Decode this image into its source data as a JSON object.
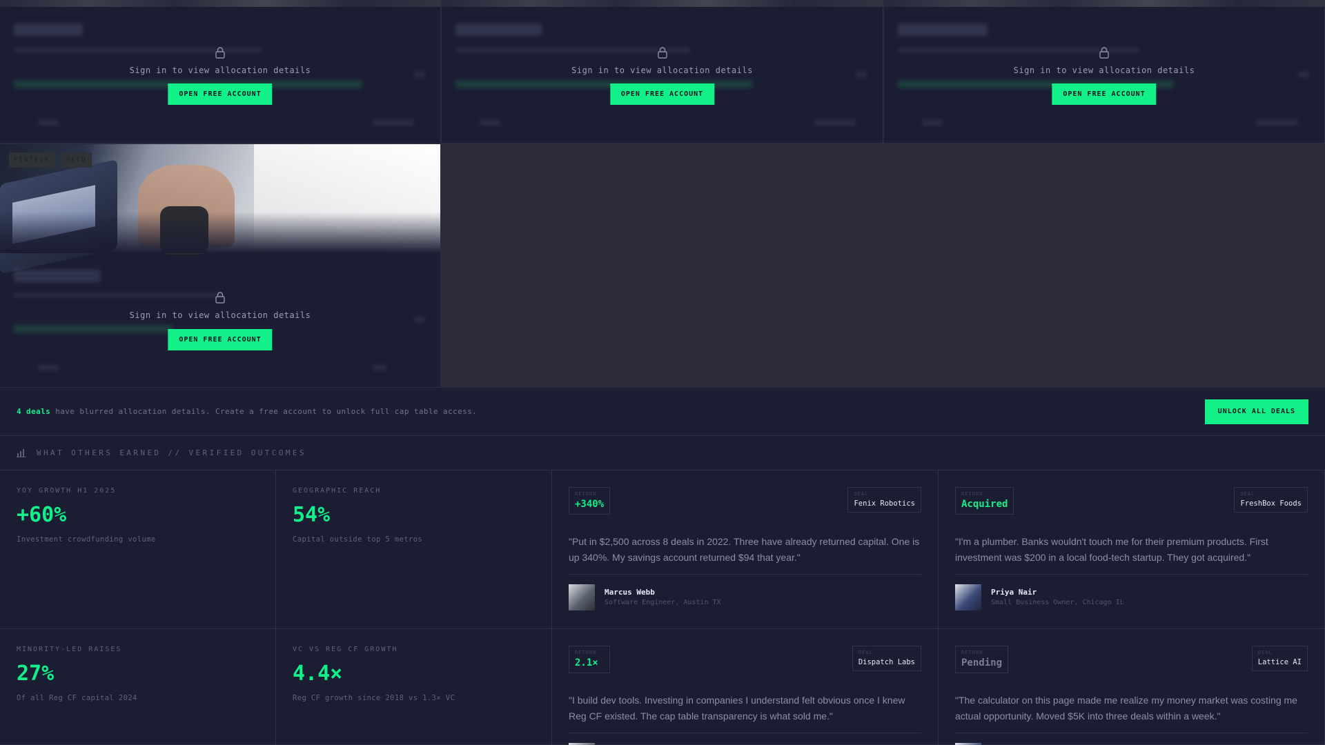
{
  "deal_cards": [
    {
      "signin": "Sign in to view allocation details",
      "cta": "OPEN FREE ACCOUNT"
    },
    {
      "signin": "Sign in to view allocation details",
      "cta": "OPEN FREE ACCOUNT"
    },
    {
      "signin": "Sign in to view allocation details",
      "cta": "OPEN FREE ACCOUNT"
    },
    {
      "signin": "Sign in to view allocation details",
      "cta": "OPEN FREE ACCOUNT",
      "tags": [
        "FINTECH",
        "SEED"
      ]
    }
  ],
  "banner": {
    "highlight": "4 deals",
    "text": "have blurred allocation details. Create a free account to unlock full cap table access.",
    "button": "UNLOCK ALL DEALS"
  },
  "outcomes": {
    "icon": "bar-chart-icon",
    "label": "WHAT OTHERS EARNED // VERIFIED OUTCOMES"
  },
  "stats": [
    {
      "label": "YOY GROWTH H1 2025",
      "value": "+60%",
      "desc": "Investment crowdfunding volume"
    },
    {
      "label": "GEOGRAPHIC REACH",
      "value": "54%",
      "desc": "Capital outside top 5 metros"
    },
    {
      "label": "MINORITY-LED RAISES",
      "value": "27%",
      "desc": "Of all Reg CF capital 2024"
    },
    {
      "label": "VC VS REG CF GROWTH",
      "value": "4.4×",
      "desc": "Reg CF growth since 2018 vs 1.3× VC"
    }
  ],
  "testimonials": [
    {
      "return_label": "RETURN",
      "return": "+340%",
      "deal_label": "DEAL",
      "deal": "Fenix Robotics",
      "quote": "\"Put in $2,500 across 8 deals in 2022. Three have already returned capital. One is up 340%. My savings account returned $94 that year.\"",
      "name": "Marcus Webb",
      "role": "Software Engineer, Austin TX"
    },
    {
      "return_label": "RETURN",
      "return": "Acquired",
      "deal_label": "DEAL",
      "deal": "FreshBox Foods",
      "quote": "\"I'm a plumber. Banks wouldn't touch me for their premium products. First investment was $200 in a local food-tech startup. They got acquired.\"",
      "name": "Priya Nair",
      "role": "Small Business Owner, Chicago IL"
    },
    {
      "return_label": "RETURN",
      "return": "2.1×",
      "deal_label": "DEAL",
      "deal": "Dispatch Labs",
      "quote": "\"I build dev tools. Investing in companies I understand felt obvious once I knew Reg CF existed. The cap table transparency is what sold me.\"",
      "name": "",
      "role": ""
    },
    {
      "return_label": "RETURN",
      "return": "Pending",
      "deal_label": "DEAL",
      "deal": "Lattice AI",
      "quote": "\"The calculator on this page made me realize my money market was costing me actual opportunity. Moved $5K into three deals within a week.\"",
      "name": "",
      "role": ""
    }
  ],
  "colors": {
    "accent": "#12f08a",
    "bg": "#1b1d33",
    "border": "#2c2f45"
  }
}
